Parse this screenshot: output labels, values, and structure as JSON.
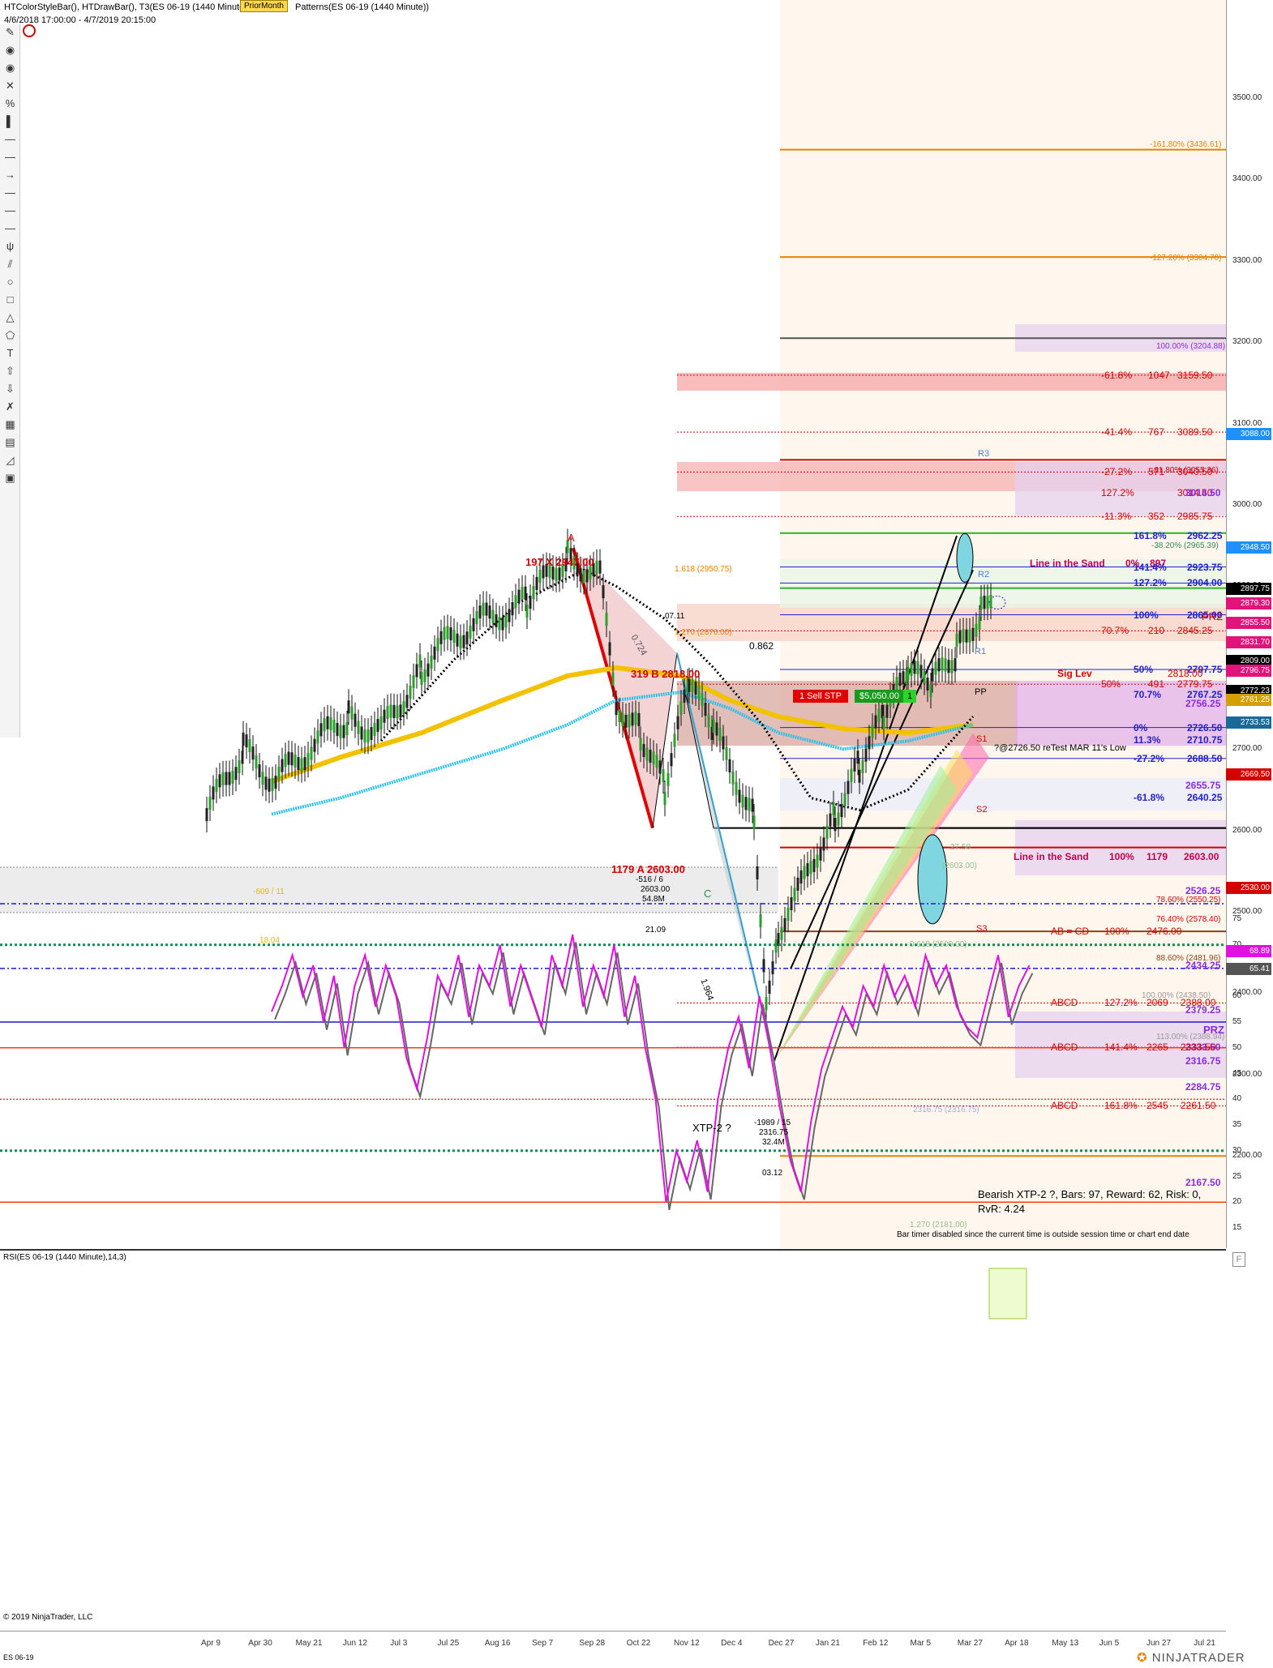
{
  "header": {
    "line1_a": "HTColorStyleBar(), HTDrawBar(), T3(ES 06-19 (1440 Minute),",
    "prior_badge": "PriorMonth",
    "line1_b": "Patterns(ES 06-19 (1440 Minute))",
    "range": "4/6/2018 17:00:00 - 4/7/2019 20:15:00"
  },
  "toolbar_icons": [
    "pencil-icon",
    "eye-icon",
    "eye-icon",
    "crosshair-icon",
    "percent-icon",
    "marker-icon",
    "line-icon",
    "line-icon",
    "arrow-icon",
    "line-icon",
    "line-icon",
    "line-icon",
    "pitchfork-icon",
    "channel-icon",
    "circle-icon",
    "rectangle-icon",
    "triangle-icon",
    "polygon-icon",
    "text-icon",
    "up-arrow-icon",
    "down-arrow-icon",
    "cross-icon",
    "gann-icon",
    "fib-icon",
    "fib-fan-icon",
    "region-icon"
  ],
  "price_axis": {
    "ticks": [
      "3500.00",
      "3400.00",
      "3300.00",
      "3200.00",
      "3100.00",
      "3000.00",
      "2900.00",
      "2800.00",
      "2700.00",
      "2600.00",
      "2500.00",
      "2400.00",
      "2300.00",
      "2200.00"
    ],
    "labels": [
      {
        "text": "3088.00",
        "color": "#1e90ff"
      },
      {
        "text": "2948.50",
        "color": "#1e90ff"
      },
      {
        "text": "2897.75",
        "color": "#000000"
      },
      {
        "text": "2879.30",
        "color": "#e0147a"
      },
      {
        "text": "2855.50",
        "color": "#e0147a"
      },
      {
        "text": "2831.70",
        "color": "#e0147a"
      },
      {
        "text": "2809.00",
        "color": "#000000"
      },
      {
        "text": "2796.75",
        "color": "#e0147a"
      },
      {
        "text": "2772.23",
        "color": "#000000"
      },
      {
        "text": "2761.25",
        "color": "#d4a000"
      },
      {
        "text": "2733.53",
        "color": "#1a6a99"
      },
      {
        "text": "2669.50",
        "color": "#d40000"
      },
      {
        "text": "2530.00",
        "color": "#d40000"
      }
    ]
  },
  "rsi_axis": {
    "ticks": [
      "75",
      "70",
      "65",
      "60",
      "55",
      "50",
      "45",
      "40",
      "35",
      "30",
      "25",
      "20",
      "15"
    ],
    "labels": [
      {
        "text": "68.89",
        "color": "#e010e0"
      },
      {
        "text": "65.41",
        "color": "#555555"
      }
    ]
  },
  "time_axis": [
    "Apr 9",
    "Apr 30",
    "May 21",
    "Jun 12",
    "Jul 3",
    "Jul 25",
    "Aug 16",
    "Sep 7",
    "Sep 28",
    "Oct 22",
    "Nov 12",
    "Dec 4",
    "Dec 27",
    "Jan 21",
    "Feb 12",
    "Mar 5",
    "Mar 27",
    "Apr 18",
    "May 13",
    "Jun 5",
    "Jun 27",
    "Jul 21"
  ],
  "fib_labels": {
    "ext_161": "-161.80% (3436.61)",
    "ext_127": "-127.20% (3304.70)",
    "ext_100": "100.00% (3204.88)",
    "ret_618": "-61.80% (3055.36)",
    "ret_382": "-38.20% (2965.39)",
    "f_1618": "1.618 (2950.75)",
    "f_1270": "1.270 (2876.00)",
    "f_0618": "0.618 (2509.00)",
    "f_1270b": "1.270 (2181.00)",
    "p_786": "78.60% (2550.25)",
    "p_764": "76.40% (2578.40)",
    "p_886": "88.60% (2481.96)",
    "p_100": "100.00% (2438.50)",
    "p_113": "113.00% (2388.94)",
    "p_2316": "2316.75 (2316.75)",
    "p_2603": "(2603.00)",
    "p_27": "27.50"
  },
  "prz_rows": [
    {
      "a": "-61.8%",
      "b": "1047",
      "c": "3159.50"
    },
    {
      "a": "-41.4%",
      "b": "767",
      "c": "3089.50"
    },
    {
      "a": "-27.2%",
      "b": "571",
      "c": "3040.50"
    },
    {
      "a": "127.2%",
      "b": "",
      "c": "3014.50"
    },
    {
      "a": "-11.3%",
      "b": "352",
      "c": "2985.75"
    },
    {
      "a": "70.7%",
      "b": "210",
      "c": "2845.25"
    },
    {
      "a": "50%",
      "b": "491",
      "c": "2779.75"
    }
  ],
  "blue_rows": [
    {
      "a": "161.8%",
      "c": "2962.25"
    },
    {
      "a": "141.4%",
      "c": "2923.75"
    },
    {
      "a": "127.2%",
      "c": "2904.00"
    },
    {
      "a": "100%",
      "c": "2865.00"
    },
    {
      "a": "50%",
      "c": "2797.75"
    },
    {
      "a": "70.7%",
      "c": "2767.25"
    },
    {
      "a": "0%",
      "c": "2726.50"
    },
    {
      "a": "11.3%",
      "c": "2710.75"
    },
    {
      "a": "-27.2%",
      "c": "2688.50"
    },
    {
      "a": "-61.8%",
      "c": "2640.25"
    }
  ],
  "purple_values": [
    "2756.25",
    "2655.75",
    "2526.25",
    "2434.25",
    "2379.25",
    "2333.50",
    "2316.75",
    "2284.75",
    "2167.50",
    "3014.50"
  ],
  "abcd_rows": [
    {
      "a": "AB = CD",
      "b": "100%",
      "c": "2476.00"
    },
    {
      "a": "ABCD",
      "b": "127.2%",
      "c": "2069",
      "d": "2388.00"
    },
    {
      "a": "ABCD",
      "b": "141.4%",
      "c": "2265",
      "d": "2333.50"
    },
    {
      "a": "ABCD",
      "b": "161.8%",
      "c": "2545",
      "d": "2261.50"
    }
  ],
  "annotations": {
    "line_sand_top": "Line in the Sand",
    "line_sand_top_pct": "0%",
    "line_sand_top_val": "897",
    "line_sand_bottom": "Line in the Sand",
    "line_sand_bottom_pct": "100%",
    "line_sand_bottom_n": "1179",
    "line_sand_bottom_val": "2603.00",
    "sig_lev": "Sig Lev",
    "sig_lev_val": "2818.00",
    "prz1": "PRZ",
    "prz2": "PRZ",
    "retest": "?@2726.50 reTest MAR 11's Low",
    "pattern_a": "A",
    "x_label": "197   X   2947.00",
    "b_label": "319   B   2818.00",
    "a_label": "1179   A   2603.00",
    "c_label": "C",
    "xtp": "XTP-2 ?",
    "low_info1": "-1989 / 15",
    "low_info2": "2316.75",
    "low_info3": "32.4M",
    "low_date": "03.12",
    "mid_info1": "-516 / 6",
    "mid_info2": "2603.00",
    "mid_info3": "54.8M",
    "mid_date": "21.09",
    "r0724": "0.724",
    "r0862": "0.862",
    "r1964": "1.964",
    "d0711": "07.11",
    "y0609": "-609 / 11",
    "y_date": "18.04",
    "pivot_r2": "R2",
    "pivot_r3": "R3",
    "pivot_r1": "R1",
    "pivot_pp": "PP",
    "pivot_s1": "S1",
    "pivot_s2": "S2",
    "pivot_s3": "S3",
    "sell_order": "1  Sell STP",
    "pnl": "$5,050.00",
    "qty": "1",
    "bearish1": "Bearish XTP-2 ?, Bars: 97, Reward: 62, Risk: 0,",
    "bearish2": "RvR: 4.24",
    "timer": "Bar timer disabled since the current time is outside session time or chart end date",
    "rsi_title": "RSI(ES 06-19 (1440 Minute),14,3)",
    "copyright": "© 2019 NinjaTrader, LLC",
    "instrument": "ES 06-19",
    "brand": "NINJATRADER"
  }
}
